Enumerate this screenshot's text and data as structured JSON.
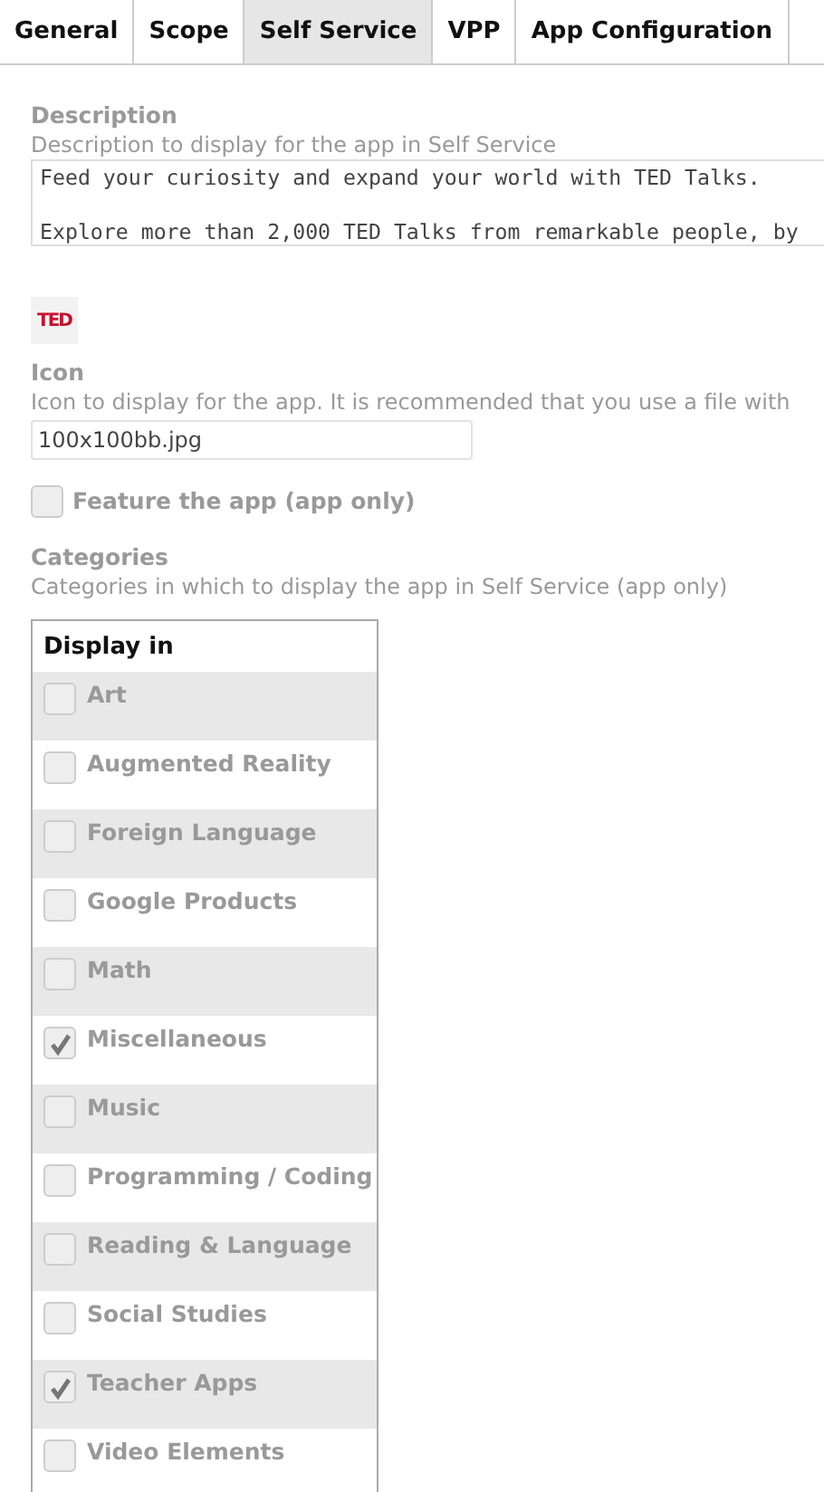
{
  "tabs": [
    {
      "label": "General",
      "selected": false
    },
    {
      "label": "Scope",
      "selected": false
    },
    {
      "label": "Self Service",
      "selected": true
    },
    {
      "label": "VPP",
      "selected": false
    },
    {
      "label": "App Configuration",
      "selected": false
    }
  ],
  "description": {
    "label": "Description",
    "help": "Description to display for the app in Self Service",
    "lines": [
      "Feed your curiosity and expand your world with TED Talks.",
      "Explore more than 2,000 TED Talks from remarkable people, by"
    ]
  },
  "icon": {
    "preview": "TED",
    "label": "Icon",
    "help": "Icon to display for the app. It is recommended that you use a file with",
    "value": "100x100bb.jpg"
  },
  "feature": {
    "label": "Feature the app (app only)",
    "checked": false
  },
  "categories": {
    "label": "Categories",
    "help": "Categories in which to display the app in Self Service (app only)",
    "header": "Display in",
    "items": [
      {
        "name": "Art",
        "checked": false
      },
      {
        "name": "Augmented Reality",
        "checked": false
      },
      {
        "name": "Foreign Language",
        "checked": false
      },
      {
        "name": "Google Products",
        "checked": false
      },
      {
        "name": "Math",
        "checked": false
      },
      {
        "name": "Miscellaneous",
        "checked": true
      },
      {
        "name": "Music",
        "checked": false
      },
      {
        "name": "Programming / Coding",
        "checked": false
      },
      {
        "name": "Reading & Language",
        "checked": false
      },
      {
        "name": "Social Studies",
        "checked": false
      },
      {
        "name": "Teacher Apps",
        "checked": true
      },
      {
        "name": "Video Elements",
        "checked": false
      }
    ]
  }
}
